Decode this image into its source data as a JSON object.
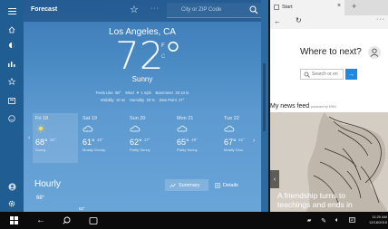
{
  "weather": {
    "app_title": "Forecast",
    "search_placeholder": "City or ZIP Code",
    "city": "Los Angeles, CA",
    "temperature": "72",
    "degree_symbol": "°",
    "unit_f": "F",
    "unit_c": "C",
    "condition": "Sunny",
    "details_line1": "Feels Like  68°    Wind  ▼ 1 mph    Barometer  30.10 in",
    "details_line2": "Visibility  10 mi    Humidity  20 %    Dew Point  27°",
    "days": [
      {
        "date": "Fri 18",
        "high": "68°",
        "low": "50°",
        "condition": "Sunny",
        "icon": "sun-icon"
      },
      {
        "date": "Sat 19",
        "high": "61°",
        "low": "45°",
        "condition": "Mostly Cloudy",
        "icon": "partly-cloudy-icon"
      },
      {
        "date": "Sun 20",
        "high": "62°",
        "low": "47°",
        "condition": "Partly Sunny",
        "icon": "partly-cloudy-icon"
      },
      {
        "date": "Mon 21",
        "high": "65°",
        "low": "49°",
        "condition": "Partly Sunny",
        "icon": "partly-cloudy-icon"
      },
      {
        "date": "Tue 22",
        "high": "67°",
        "low": "51°",
        "condition": "Mostly Clou",
        "icon": "partly-cloudy-icon"
      }
    ],
    "hourly_label": "Hourly",
    "summary_label": "Summary",
    "details_label": "Details",
    "hourly_temp1": "68°",
    "hourly_temp2": "62°"
  },
  "edge": {
    "tab_title": "Start",
    "heading": "Where to next?",
    "search_placeholder": "Search or en",
    "feed_title": "My news feed",
    "feed_powered": "powered by MSN",
    "headline_line1": "A friendship turns to",
    "headline_line2": "teachings and ends in"
  },
  "taskbar": {
    "time": "11:20 AM",
    "date": "12/18/2015"
  },
  "colors": {
    "weather_bg": "#4b8bc4",
    "sidebar_bg": "#1f5d92",
    "edge_accent": "#1e88e5",
    "taskbar_bg": "#0b0b0b"
  }
}
